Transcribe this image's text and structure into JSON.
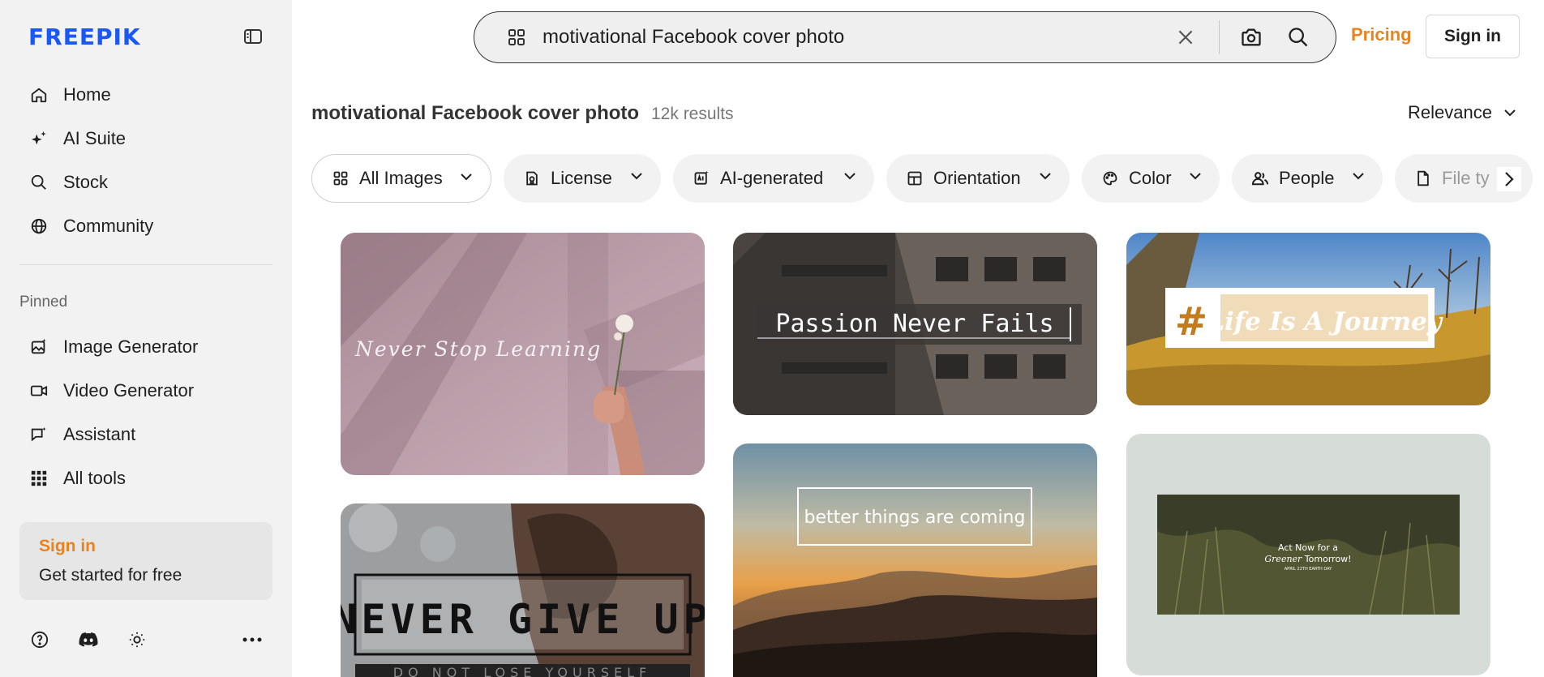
{
  "brand": {
    "logo_text": "FREEPIK",
    "accent": "#1a57f5",
    "highlight": "#e8831e"
  },
  "sidebar": {
    "nav": [
      {
        "label": "Home",
        "icon": "home-icon"
      },
      {
        "label": "AI Suite",
        "icon": "sparkles-icon"
      },
      {
        "label": "Stock",
        "icon": "search-icon"
      },
      {
        "label": "Community",
        "icon": "globe-icon"
      }
    ],
    "pinned_label": "Pinned",
    "pinned": [
      {
        "label": "Image Generator",
        "icon": "image-generator-icon"
      },
      {
        "label": "Video Generator",
        "icon": "video-icon"
      },
      {
        "label": "Assistant",
        "icon": "chat-icon"
      },
      {
        "label": "All tools",
        "icon": "grid-dots-icon"
      }
    ],
    "signin_card": {
      "title": "Sign in",
      "subtitle": "Get started for free"
    },
    "bottom_icons": [
      "help-icon",
      "discord-icon",
      "theme-sun-icon",
      "more-icon"
    ]
  },
  "header": {
    "search_value": "motivational Facebook cover photo",
    "pricing": "Pricing",
    "signin": "Sign in"
  },
  "results": {
    "title": "motivational Facebook cover photo",
    "count": "12k results",
    "sort": "Relevance"
  },
  "filters": [
    {
      "label": "All Images",
      "icon": "grid-icon"
    },
    {
      "label": "License",
      "icon": "license-icon"
    },
    {
      "label": "AI-generated",
      "icon": "ai-icon"
    },
    {
      "label": "Orientation",
      "icon": "layout-icon"
    },
    {
      "label": "Color",
      "icon": "palette-icon"
    },
    {
      "label": "People",
      "icon": "people-icon"
    },
    {
      "label": "File ty",
      "icon": "file-icon"
    }
  ],
  "cards": [
    {
      "caption": "Never Stop Learning"
    },
    {
      "caption": "Passion Never Fails"
    },
    {
      "hash": "#",
      "caption": "Life Is A Journey"
    },
    {
      "caption": "NEVER GIVE UP",
      "sub": "DO NOT LOSE YOURSELF"
    },
    {
      "caption": "better things are coming"
    },
    {
      "line1": "Act Now for a",
      "italic": "Greener",
      "line2": " Tomorrow!",
      "small": "APRIL 22TH EARTH DAY"
    }
  ]
}
